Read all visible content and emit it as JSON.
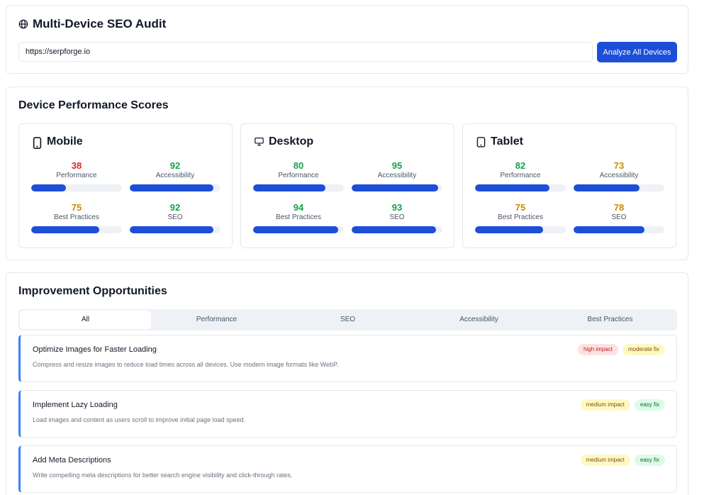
{
  "audit": {
    "title": "Multi-Device SEO Audit",
    "url_value": "https://serpforge.io",
    "analyze_label": "Analyze All Devices"
  },
  "scores": {
    "title": "Device Performance Scores",
    "devices": [
      {
        "name": "Mobile",
        "icon": "smartphone-icon",
        "metrics": [
          {
            "label": "Performance",
            "value": "38",
            "color": "#dc2626",
            "fill": 0.38
          },
          {
            "label": "Accessibility",
            "value": "92",
            "color": "#16a34a",
            "fill": 0.92
          },
          {
            "label": "Best Practices",
            "value": "75",
            "color": "#ca8a04",
            "fill": 0.75
          },
          {
            "label": "SEO",
            "value": "92",
            "color": "#16a34a",
            "fill": 0.92
          }
        ]
      },
      {
        "name": "Desktop",
        "icon": "monitor-icon",
        "metrics": [
          {
            "label": "Performance",
            "value": "80",
            "color": "#16a34a",
            "fill": 0.8
          },
          {
            "label": "Accessibility",
            "value": "95",
            "color": "#16a34a",
            "fill": 0.95
          },
          {
            "label": "Best Practices",
            "value": "94",
            "color": "#16a34a",
            "fill": 0.94
          },
          {
            "label": "SEO",
            "value": "93",
            "color": "#16a34a",
            "fill": 0.93
          }
        ]
      },
      {
        "name": "Tablet",
        "icon": "tablet-icon",
        "metrics": [
          {
            "label": "Performance",
            "value": "82",
            "color": "#16a34a",
            "fill": 0.82
          },
          {
            "label": "Accessibility",
            "value": "73",
            "color": "#ca8a04",
            "fill": 0.73
          },
          {
            "label": "Best Practices",
            "value": "75",
            "color": "#ca8a04",
            "fill": 0.75
          },
          {
            "label": "SEO",
            "value": "78",
            "color": "#ca8a04",
            "fill": 0.78
          }
        ]
      }
    ]
  },
  "opportunities": {
    "title": "Improvement Opportunities",
    "tabs": [
      {
        "label": "All",
        "active": true
      },
      {
        "label": "Performance",
        "active": false
      },
      {
        "label": "SEO",
        "active": false
      },
      {
        "label": "Accessibility",
        "active": false
      },
      {
        "label": "Best Practices",
        "active": false
      }
    ],
    "items": [
      {
        "title": "Optimize Images for Faster Loading",
        "description": "Compress and resize images to reduce load times across all devices. Use modern image formats like WebP.",
        "badges": [
          {
            "label": "high impact",
            "kind": "high"
          },
          {
            "label": "moderate fix",
            "kind": "moderate"
          }
        ]
      },
      {
        "title": "Implement Lazy Loading",
        "description": "Load images and content as users scroll to improve initial page load speed.",
        "badges": [
          {
            "label": "medium impact",
            "kind": "medium"
          },
          {
            "label": "easy fix",
            "kind": "easy"
          }
        ]
      },
      {
        "title": "Add Meta Descriptions",
        "description": "Write compelling meta descriptions for better search engine visibility and click-through rates.",
        "badges": [
          {
            "label": "medium impact",
            "kind": "medium"
          },
          {
            "label": "easy fix",
            "kind": "easy"
          }
        ]
      }
    ]
  },
  "colors": {
    "accent": "#1d4ed8",
    "opportunity_border": "#3b82f6"
  }
}
